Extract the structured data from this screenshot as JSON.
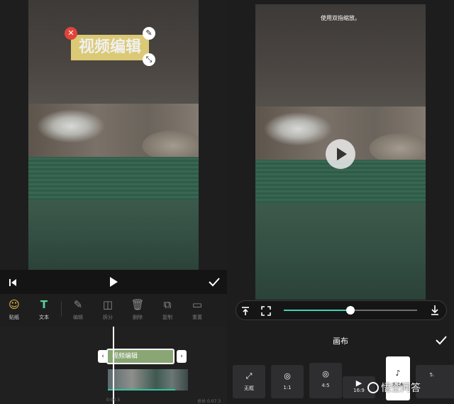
{
  "left_panel": {
    "sticker_text": "视频编辑",
    "sticker_icons": {
      "close": "close-icon",
      "edit": "pencil-icon",
      "resize": "resize-icon"
    },
    "controls": {
      "skip_back": "skip-back-icon",
      "play": "play-icon",
      "confirm": "check-icon"
    },
    "tools": [
      {
        "label": "贴纸",
        "icon": "emoji-sticker-icon"
      },
      {
        "label": "文本",
        "icon": "text-add-icon"
      },
      {
        "label": "编辑",
        "icon": "pencil-icon"
      },
      {
        "label": "拆分",
        "icon": "split-icon"
      },
      {
        "label": "删除",
        "icon": "trash-icon"
      },
      {
        "label": "复制",
        "icon": "copy-icon"
      },
      {
        "label": "重置",
        "icon": "reset-icon"
      }
    ],
    "timeline": {
      "text_clip": "视频编辑",
      "time_start": "0:00.5",
      "time_total": "总长 0:07.3"
    }
  },
  "right_panel": {
    "hint": "使用双指缩放。",
    "scrubber": {
      "progress": 0.5,
      "top_icon": "align-top-icon",
      "fullscreen_icon": "fullscreen-icon",
      "download_icon": "download-icon"
    },
    "canvas_title": "画布",
    "ratios": [
      {
        "label": "无框",
        "icon": "no-frame-icon",
        "selected": false
      },
      {
        "label": "1:1",
        "icon": "instagram-icon",
        "selected": false
      },
      {
        "label": "4:5",
        "icon": "instagram-icon",
        "selected": false
      },
      {
        "label": "16:9",
        "icon": "youtube-icon",
        "selected": false
      },
      {
        "label": "9:16",
        "icon": "tiktok-icon",
        "selected": true
      },
      {
        "label": "5.",
        "icon": "apple-icon",
        "selected": false
      }
    ],
    "watermark": "悟空问答",
    "colors": {
      "accent": "#3fd3b4",
      "sticker_bg": "#e8d57a",
      "clip_bg": "#89a674"
    }
  }
}
